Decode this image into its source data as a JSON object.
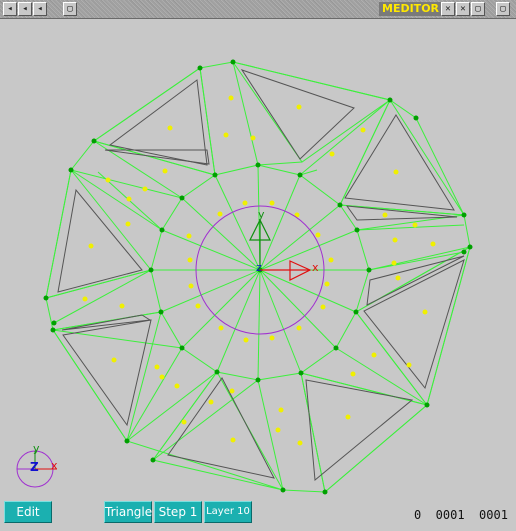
{
  "window": {
    "title": "MEDITOR",
    "left_buttons": [
      "◂",
      "◂",
      "◂",
      "▢"
    ],
    "right_buttons": [
      "✕",
      "✕",
      "▢",
      "▢"
    ]
  },
  "toolbar": {
    "edit_label": "Edit",
    "triangle_label": "Triangle",
    "step_label": "Step 1",
    "layer_label": "Layer 10"
  },
  "status": {
    "text": "0  0001  0001"
  },
  "axes": {
    "main_x": "x",
    "main_y": "y",
    "main_z": "z",
    "corner_x": "x",
    "corner_y": "y",
    "corner_z": "Z"
  },
  "colors": {
    "mesh_edge": "#3cf03c",
    "vertex": "#00a000",
    "centroid": "#f0f000",
    "circle": "#a030d0",
    "x_axis": "#e01010",
    "y_axis": "#109010",
    "z_axis": "#1010d0",
    "button_bg": "#1bb0b0"
  }
}
